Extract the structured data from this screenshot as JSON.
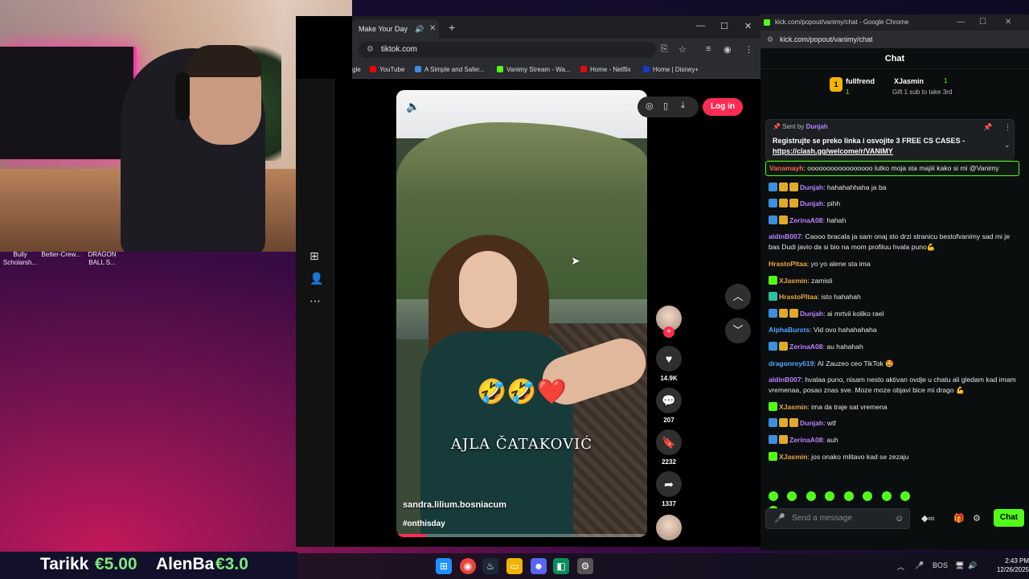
{
  "desktop": {
    "icons": [
      {
        "label": "Bully\nScholarsh..."
      },
      {
        "label": "Better-Crew..."
      },
      {
        "label": "DRAGON\nBALL S..."
      }
    ]
  },
  "browser": {
    "tab_title": "Make Your Day",
    "address": "tiktok.com",
    "bookmarks": [
      {
        "label": "gle",
        "color": "#4285f4"
      },
      {
        "label": "YouTube",
        "color": "#ff0000"
      },
      {
        "label": "A Simple and Safer...",
        "color": "#3c8ee0"
      },
      {
        "label": "Vanimy Stream - Wa...",
        "color": "#53fc18"
      },
      {
        "label": "Home - Netflix",
        "color": "#e50914"
      },
      {
        "label": "Home | Disney+",
        "color": "#113ccf"
      }
    ]
  },
  "tiktok": {
    "login_label": "Log in",
    "video": {
      "emoji": "🤣🤣❤️",
      "caption": "AJLA ČATAKOVIĆ",
      "username": "sandra.lilium.bosniacum",
      "hashtag": "#onthisday",
      "progress": 0.12
    },
    "actions": {
      "likes": "14.9K",
      "comments": "207",
      "saves": "2232",
      "shares": "1337"
    }
  },
  "chat_window": {
    "title": "kick.com/popout/vanimy/chat - Google Chrome",
    "url": "kick.com/popout/vanimy/chat",
    "header": "Chat",
    "gift": {
      "badge": "1",
      "gifter": "fullfrend",
      "gifter_count": "1",
      "recipient": "XJasmin",
      "recipient_count": "1",
      "sub_text": "Gift 1 sub to take 3rd"
    },
    "pinned": {
      "sent_by_label": "Sent by",
      "sent_by_user": "Dunjah",
      "message": "Registrujte se preko linka i osvojite 3 FREE CS CASES",
      "link": "https://clash.gg/welcome/r/VANIMY",
      "dash": "-"
    },
    "messages": [
      {
        "user": "Vanamayh",
        "color": "#ff5c5c",
        "text": "ooooooooooooooooo lutko moja sta majiii kako si mi @Vanimy",
        "badges": [],
        "highlight": true
      },
      {
        "user": "Dunjah",
        "color": "#b980ff",
        "text": "hahahahhaha ja ba",
        "badges": [
          "b-blue",
          "b-gold",
          "b-gold"
        ]
      },
      {
        "user": "Dunjah",
        "color": "#b980ff",
        "text": "pihh",
        "badges": [
          "b-blue",
          "b-gold",
          "b-gold"
        ]
      },
      {
        "user": "ZerinaA08",
        "color": "#b980ff",
        "text": "hahah",
        "badges": [
          "b-blue",
          "b-gold"
        ]
      },
      {
        "user": "aldinB007",
        "color": "#b980ff",
        "text": "Caooo bracala ja sam onaj sto drzi stranicu bestofvanimy sad mi je bas Dudi javio da si bio na mom profiluu hvala puno💪",
        "badges": []
      },
      {
        "user": "HrastoPltaa",
        "color": "#e8a840",
        "text": "yo yo alene sta ima",
        "badges": []
      },
      {
        "user": "XJasmin",
        "color": "#e8a840",
        "text": "zamisli",
        "badges": [
          "b-green"
        ]
      },
      {
        "user": "HrastoPltaa",
        "color": "#e8a840",
        "text": "isto hahahah",
        "badges": [
          "b-teal"
        ]
      },
      {
        "user": "Dunjah",
        "color": "#b980ff",
        "text": "ai mrtvii koliko rael",
        "badges": [
          "b-blue",
          "b-gold",
          "b-gold"
        ]
      },
      {
        "user": "AlphaBursts",
        "color": "#4fa8ff",
        "text": "Vid ovo hahahahaha",
        "badges": []
      },
      {
        "user": "ZerinaA08",
        "color": "#b980ff",
        "text": "au hahahah",
        "badges": [
          "b-blue",
          "b-gold"
        ]
      },
      {
        "user": "dragonrey619",
        "color": "#4fa8ff",
        "text": "AI Zauzeo ceo TikTok 🤩",
        "badges": []
      },
      {
        "user": "aldinB007",
        "color": "#b980ff",
        "text": "hvalaa puno, nisam nesto aktivan ovdje u chatu ali gledam kad imam vremenaa, posao znas sve. Moze moze objavi bice mi drago 💪",
        "badges": []
      },
      {
        "user": "XJasmin",
        "color": "#e8a840",
        "text": "ima da traje sat vremena",
        "badges": [
          "b-green"
        ]
      },
      {
        "user": "Dunjah",
        "color": "#b980ff",
        "text": "wtf",
        "badges": [
          "b-blue",
          "b-gold",
          "b-gold"
        ]
      },
      {
        "user": "ZerinaA08",
        "color": "#b980ff",
        "text": "auh",
        "badges": [
          "b-blue",
          "b-gold"
        ]
      },
      {
        "user": "XJasmin",
        "color": "#e8a840",
        "text": "jos onako mlitavo kad se zezaju",
        "badges": [
          "b-green"
        ]
      }
    ],
    "input_placeholder": "Send a message",
    "send_label": "Chat"
  },
  "ticker": [
    {
      "name": "Tarikk",
      "amount": "€5.00"
    },
    {
      "name": "AlenBa",
      "amount": "€3.0"
    }
  ],
  "taskbar": {
    "lang": "BOS",
    "time": "2:43 PM",
    "date": "12/26/2025"
  }
}
